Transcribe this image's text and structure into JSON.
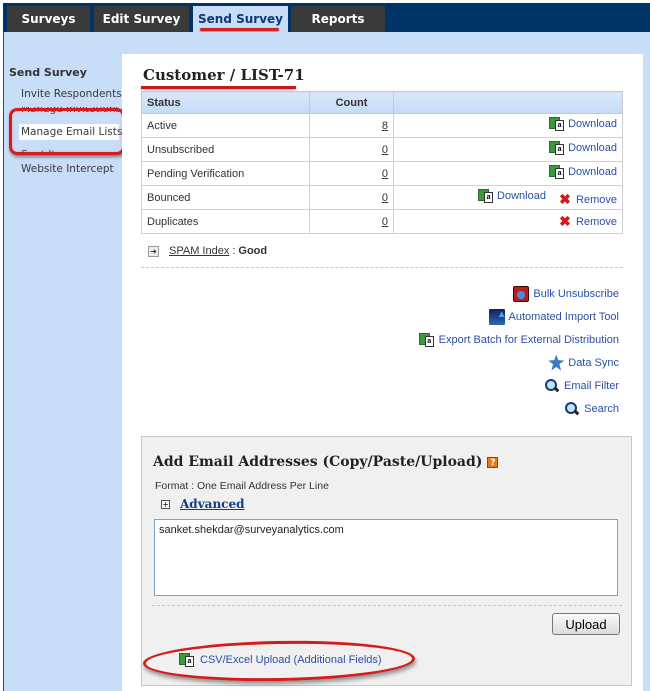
{
  "nav": {
    "tabs": [
      {
        "label": "Surveys",
        "active": false
      },
      {
        "label": "Edit Survey",
        "active": false
      },
      {
        "label": "Send Survey",
        "active": true
      },
      {
        "label": "Reports",
        "active": false
      }
    ]
  },
  "sidebar": {
    "title": "Send Survey",
    "items": [
      {
        "label": "Invite Respondents"
      },
      {
        "label": "Manage Invitations"
      },
      {
        "label": "Manage Email Lists",
        "selected": true
      },
      {
        "label": "Sent Items"
      },
      {
        "label": "Website Intercept"
      }
    ]
  },
  "page": {
    "title": "Customer / LIST-71"
  },
  "table": {
    "headers": {
      "status": "Status",
      "count": "Count"
    },
    "rows": [
      {
        "status": "Active",
        "count": "8",
        "actions": [
          "Download"
        ]
      },
      {
        "status": "Unsubscribed",
        "count": "0",
        "actions": [
          "Download"
        ]
      },
      {
        "status": "Pending Verification",
        "count": "0",
        "actions": [
          "Download"
        ]
      },
      {
        "status": "Bounced",
        "count": "0",
        "actions": [
          "Download",
          "Remove"
        ]
      },
      {
        "status": "Duplicates",
        "count": "0",
        "actions": [
          "Remove"
        ]
      }
    ],
    "download_label": "Download",
    "remove_label": "Remove"
  },
  "spam": {
    "label": "SPAM Index",
    "separator": ":",
    "value": "Good"
  },
  "tools": [
    {
      "label": "Bulk Unsubscribe",
      "icon": "bulk-unsubscribe-icon"
    },
    {
      "label": "Automated Import Tool",
      "icon": "import-tool-icon"
    },
    {
      "label": "Export Batch for External Distribution",
      "icon": "excel-icon"
    },
    {
      "label": "Data Sync",
      "icon": "data-sync-icon"
    },
    {
      "label": "Email Filter",
      "icon": "magnifier-icon"
    },
    {
      "label": "Search",
      "icon": "magnifier-icon"
    }
  ],
  "add_email": {
    "title": "Add Email Addresses (Copy/Paste/Upload)",
    "help_glyph": "?",
    "format": "Format : One Email Address Per Line",
    "advanced_label": "Advanced",
    "textarea_value": "sanket.shekdar@surveyanalytics.com",
    "upload_label": "Upload",
    "csv_label": "CSV/Excel Upload (Additional Fields)"
  }
}
